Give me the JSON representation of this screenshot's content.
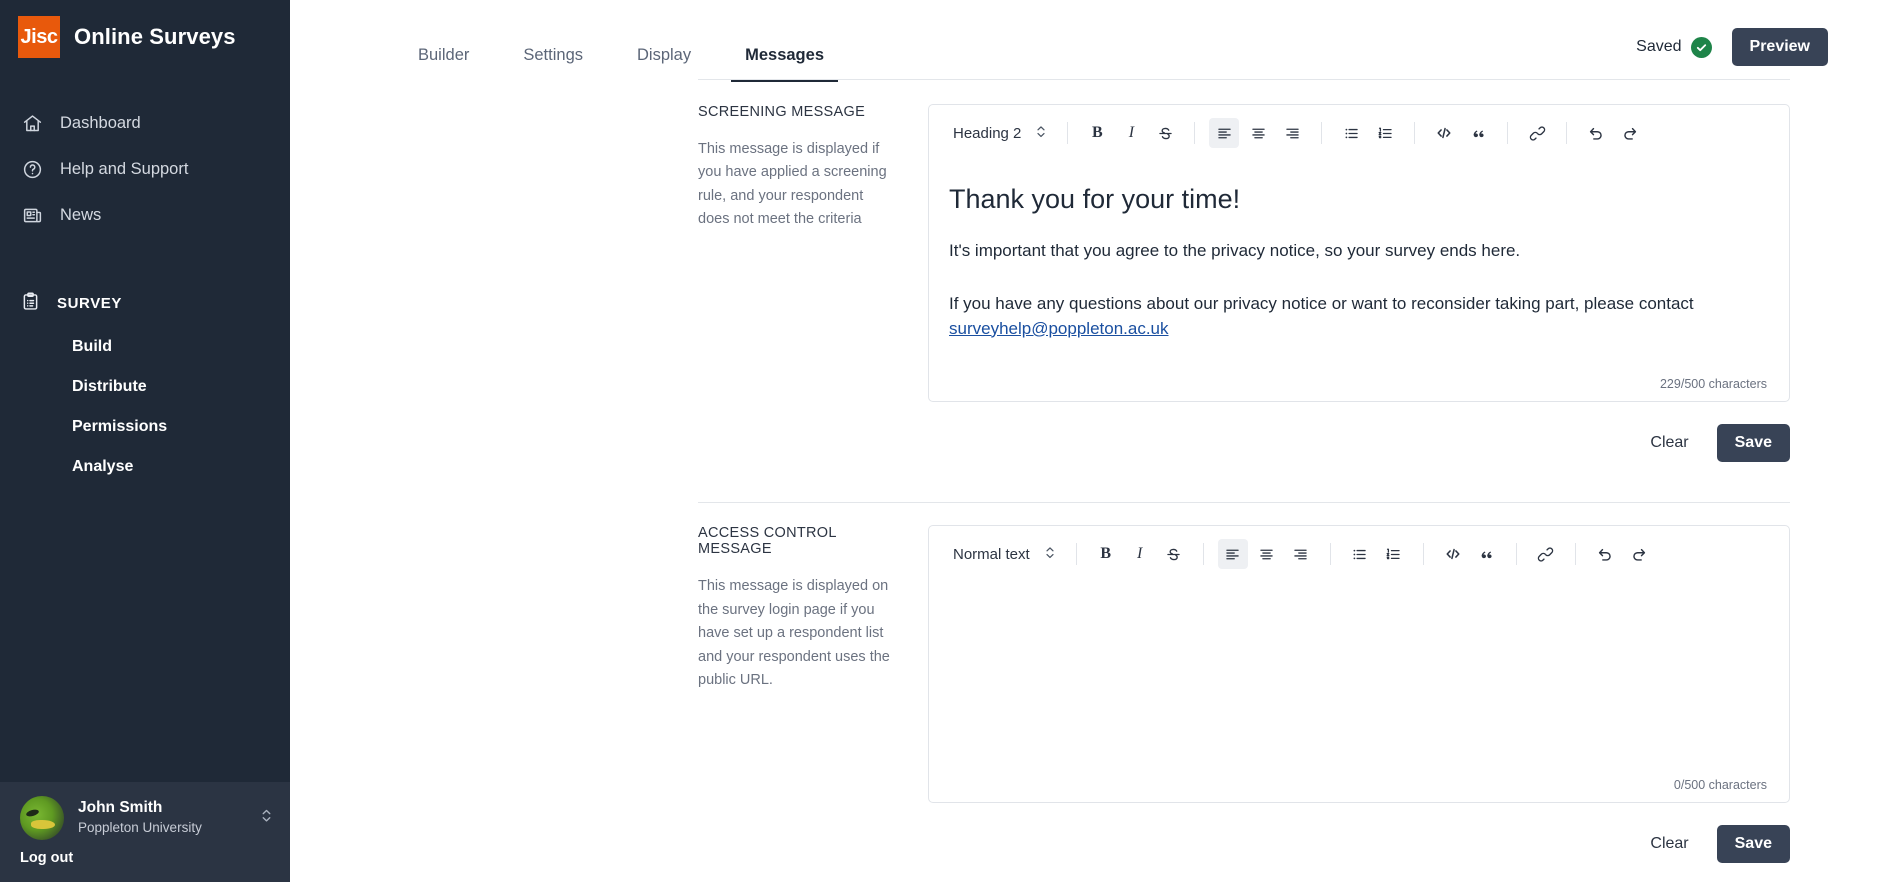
{
  "brand": {
    "logo_text": "Jisc",
    "title": "Online Surveys"
  },
  "sidebar": {
    "items": [
      {
        "label": "Dashboard",
        "icon": "home-icon"
      },
      {
        "label": "Help and Support",
        "icon": "question-circle-icon"
      },
      {
        "label": "News",
        "icon": "newspaper-icon"
      }
    ],
    "section": {
      "label": "SURVEY",
      "icon": "clipboard-icon"
    },
    "sub_items": [
      {
        "label": "Build"
      },
      {
        "label": "Distribute"
      },
      {
        "label": "Permissions"
      },
      {
        "label": "Analyse"
      }
    ],
    "user": {
      "name": "John Smith",
      "org": "Poppleton University",
      "logout_label": "Log out",
      "switch_icon": "chevron-up-down-icon",
      "avatar": "avatar"
    }
  },
  "header": {
    "tabs": [
      {
        "label": "Builder",
        "active": false
      },
      {
        "label": "Settings",
        "active": false
      },
      {
        "label": "Display",
        "active": false
      },
      {
        "label": "Messages",
        "active": true
      }
    ],
    "saved_label": "Saved",
    "saved_icon": "check-circle-icon",
    "preview_label": "Preview"
  },
  "sections": [
    {
      "label": "SCREENING MESSAGE",
      "description": "This message is displayed if you have applied a screening rule, and your respondent does not meet the criteria",
      "toolbar": {
        "block_format": "Heading 2",
        "block_icon": "chevron-up-down-icon",
        "buttons": [
          {
            "name": "bold-icon",
            "glyph": "B"
          },
          {
            "name": "italic-icon",
            "glyph": "I"
          },
          {
            "name": "strikethrough-icon",
            "glyph": "S"
          },
          {
            "name": "align-left-icon",
            "glyph": ""
          },
          {
            "name": "align-center-icon",
            "glyph": ""
          },
          {
            "name": "align-right-icon",
            "glyph": ""
          },
          {
            "name": "bullet-list-icon",
            "glyph": ""
          },
          {
            "name": "numbered-list-icon",
            "glyph": ""
          },
          {
            "name": "code-block-icon",
            "glyph": "</>"
          },
          {
            "name": "blockquote-icon",
            "glyph": "”"
          },
          {
            "name": "link-icon",
            "glyph": ""
          },
          {
            "name": "undo-icon",
            "glyph": ""
          },
          {
            "name": "redo-icon",
            "glyph": ""
          }
        ]
      },
      "content": {
        "heading": "Thank you for your time!",
        "paragraph1": "It's important that you agree to the privacy notice, so your survey ends here.",
        "paragraph2_before": "If you have any questions about our privacy notice or want to reconsider taking part, please contact ",
        "paragraph2_link": "surveyhelp@poppleton.ac.uk"
      },
      "counter": "229/500 characters",
      "clear_label": "Clear",
      "save_label": "Save"
    },
    {
      "label": "ACCESS CONTROL MESSAGE",
      "description": "This message is displayed on the survey login page if you have set up a respondent list and your respondent uses the public URL.",
      "toolbar": {
        "block_format": "Normal text",
        "block_icon": "chevron-up-down-icon"
      },
      "content": {
        "heading": "",
        "paragraph1": "",
        "paragraph2_before": "",
        "paragraph2_link": ""
      },
      "counter": "0/500 characters",
      "clear_label": "Clear",
      "save_label": "Save"
    }
  ],
  "colors": {
    "sidebar_bg": "#1f2937",
    "brand_orange": "#e8590c",
    "accent_dark": "#384356",
    "saved_green": "#1e8449",
    "link_blue": "#1a4fa0"
  }
}
